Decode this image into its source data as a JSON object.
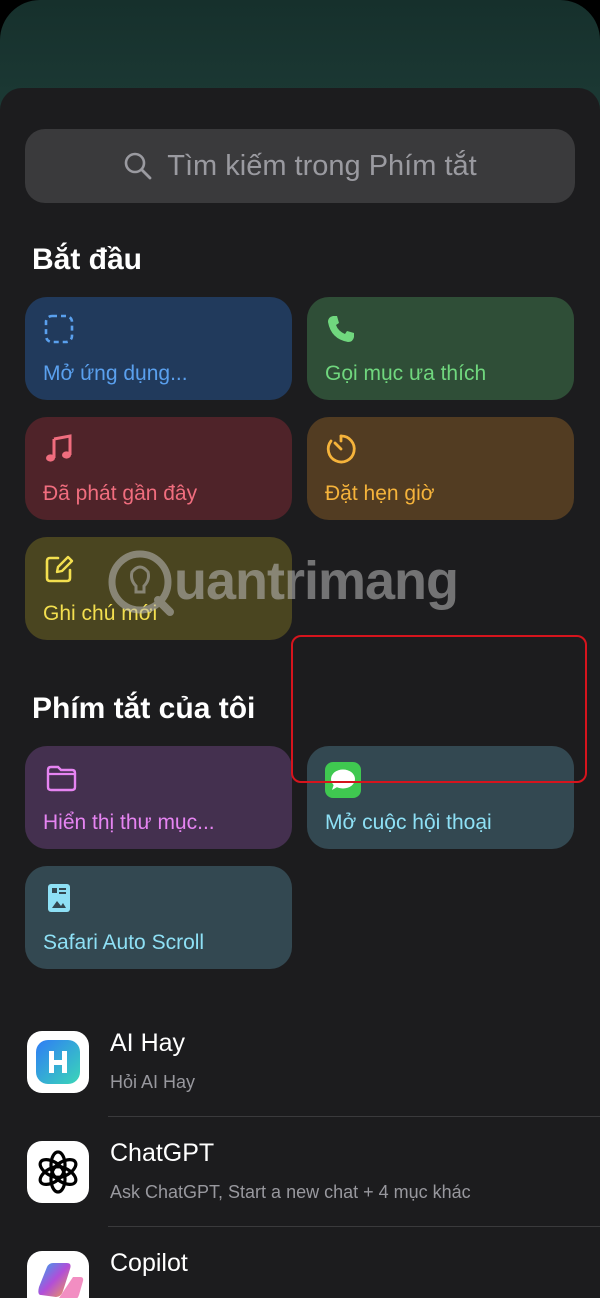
{
  "search": {
    "placeholder": "Tìm kiếm trong Phím tắt"
  },
  "sections": {
    "starter_title": "Bắt đầu",
    "mine_title": "Phím tắt của tôi"
  },
  "starter_tiles": [
    {
      "label": "Mở ứng dụng...",
      "icon": "dashed-square-icon"
    },
    {
      "label": "Gọi mục ưa thích",
      "icon": "phone-icon"
    },
    {
      "label": "Đã phát gần đây",
      "icon": "music-note-icon"
    },
    {
      "label": "Đặt hẹn giờ",
      "icon": "timer-icon"
    },
    {
      "label": "Ghi chú mới",
      "icon": "compose-icon"
    }
  ],
  "my_tiles": [
    {
      "label": "Hiển thị thư mục...",
      "icon": "folder-icon"
    },
    {
      "label": "Mở cuộc hội thoại",
      "icon": "messages-icon"
    },
    {
      "label": "Safari Auto Scroll",
      "icon": "document-image-icon"
    }
  ],
  "apps": [
    {
      "name": "AI Hay",
      "sub": "Hỏi AI Hay"
    },
    {
      "name": "ChatGPT",
      "sub": "Ask ChatGPT, Start a new chat + 4 mục khác"
    },
    {
      "name": "Copilot",
      "sub": ""
    }
  ],
  "watermark": "uantrimang",
  "colors": {
    "accent_highlight": "#d6141d",
    "blue_tile": "#213a5c",
    "green_tile": "#2f4e37",
    "red_tile": "#4f2329",
    "orange_tile": "#523c22",
    "yellow_tile": "#4a4520",
    "purple_tile": "#44304f",
    "teal_tile": "#334851"
  }
}
